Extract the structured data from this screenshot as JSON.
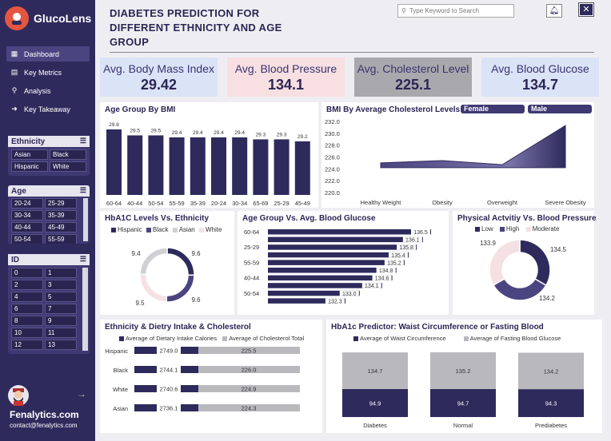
{
  "app": {
    "name": "GlucoLens"
  },
  "header": {
    "title_lines": [
      "DIABETES PREDICTION FOR",
      "DIFFERENT ETHNICITY AND AGE",
      "GROUP"
    ],
    "search_placeholder": "Type Keyword to Search"
  },
  "nav": [
    {
      "label": "Dashboard",
      "icon": "grid-icon",
      "active": true
    },
    {
      "label": "Key Metrics",
      "icon": "chart-icon",
      "active": false
    },
    {
      "label": "Analysis",
      "icon": "search-icon",
      "active": false
    },
    {
      "label": "Key Takeaway",
      "icon": "arrow-icon",
      "active": false
    }
  ],
  "filters": {
    "ethnicity": {
      "title": "Ethnicity",
      "items": [
        "Asian",
        "Black",
        "Hispanic",
        "White"
      ]
    },
    "age": {
      "title": "Age",
      "items": [
        "20-24",
        "25-29",
        "30-34",
        "35-39",
        "40-44",
        "45-49",
        "50-54",
        "55-59"
      ]
    },
    "id": {
      "title": "ID",
      "items": [
        "0",
        "1",
        "2",
        "3",
        "4",
        "5",
        "6",
        "7",
        "8",
        "9",
        "10",
        "11",
        "12",
        "13"
      ]
    }
  },
  "profile": {
    "name": "Fenalytics.com",
    "email": "contact@fenalytics.com"
  },
  "kpis": [
    {
      "label": "Avg. Body Mass Index",
      "value": "29.42",
      "color": "#dbe3f7"
    },
    {
      "label": "Avg. Blood Pressure",
      "value": "134.1",
      "color": "#f7dfe2"
    },
    {
      "label": "Avg. Cholesterol Level",
      "value": "225.1",
      "color": "#a9a8ad"
    },
    {
      "label": "Avg. Blood Glucose",
      "value": "134.7",
      "color": "#dbe3f7"
    }
  ],
  "colors": {
    "primary": "#2f2a5c",
    "mid": "#44407a",
    "light": "#cfcfd3",
    "pink": "#f5e0e3"
  },
  "chart_data": [
    {
      "id": "bmi_age",
      "type": "bar",
      "title": "Age Group By BMI",
      "categories": [
        "60-64",
        "40-44",
        "50-54",
        "55-59",
        "35-39",
        "20-24",
        "30-34",
        "65-69",
        "25-29",
        "45-49"
      ],
      "values": [
        29.8,
        29.5,
        29.5,
        29.4,
        29.4,
        29.4,
        29.4,
        29.3,
        29.3,
        29.2
      ]
    },
    {
      "id": "bmi_chol",
      "type": "area",
      "title": "BMI By Average Cholesterol Levels",
      "legend": [
        "Female",
        "Male"
      ],
      "categories": [
        "Healthy Weight",
        "Obesity",
        "Overweight",
        "Severe Obesity"
      ],
      "values": [
        225.0,
        225.4,
        224.7,
        231.3
      ],
      "yticks": [
        232.0,
        230.0,
        228.0,
        226.0,
        224.0,
        222.0,
        220.0
      ],
      "ylim": [
        220,
        232
      ]
    },
    {
      "id": "hba1c_eth",
      "type": "pie",
      "title": "HbA1C Levels Vs. Ethnicity",
      "categories": [
        "Hispanic",
        "Black",
        "Asian",
        "White"
      ],
      "values": [
        9.6,
        9.6,
        9.5,
        9.4
      ]
    },
    {
      "id": "age_glucose",
      "type": "bar",
      "title": "Age Group Vs. Avg. Blood Glucose",
      "categories": [
        "60-64",
        "",
        "25-29",
        "",
        "55-59",
        "",
        "40-44",
        "",
        "50-54",
        ""
      ],
      "values": [
        136.5,
        136.1,
        135.8,
        135.4,
        135.2,
        134.8,
        134.6,
        134.1,
        133.0,
        132.3
      ]
    },
    {
      "id": "activity_bp",
      "type": "pie",
      "title": "Physical Actvitiy Vs. Blood Pressure",
      "categories": [
        "Low",
        "High",
        "Moderate"
      ],
      "values": [
        134.5,
        134.2,
        133.9
      ]
    },
    {
      "id": "diet_chol",
      "type": "bar",
      "title": "Ethnicity & Dietry Intake & Cholesterol",
      "categories": [
        "Hispanic",
        "Black",
        "White",
        "Asian"
      ],
      "series": [
        {
          "name": "Average of Dietary Intake Calories",
          "values": [
            2749.0,
            2744.1,
            2740.6,
            2736.1
          ]
        },
        {
          "name": "Average of Cholesterol Total",
          "values": [
            225.5,
            226.0,
            224.9,
            224.3
          ]
        }
      ]
    },
    {
      "id": "waist_glucose",
      "type": "bar",
      "title": "HbA1c Predictor: Waist Circumference or Fasting Blood",
      "categories": [
        "Diabetes",
        "Normal",
        "Prediabetes"
      ],
      "series": [
        {
          "name": "Average of Waist Circumference",
          "values": [
            94.9,
            94.7,
            94.3
          ]
        },
        {
          "name": "Average of Fasting Blood Glucose",
          "values": [
            134.7,
            135.2,
            134.2
          ]
        }
      ]
    }
  ]
}
